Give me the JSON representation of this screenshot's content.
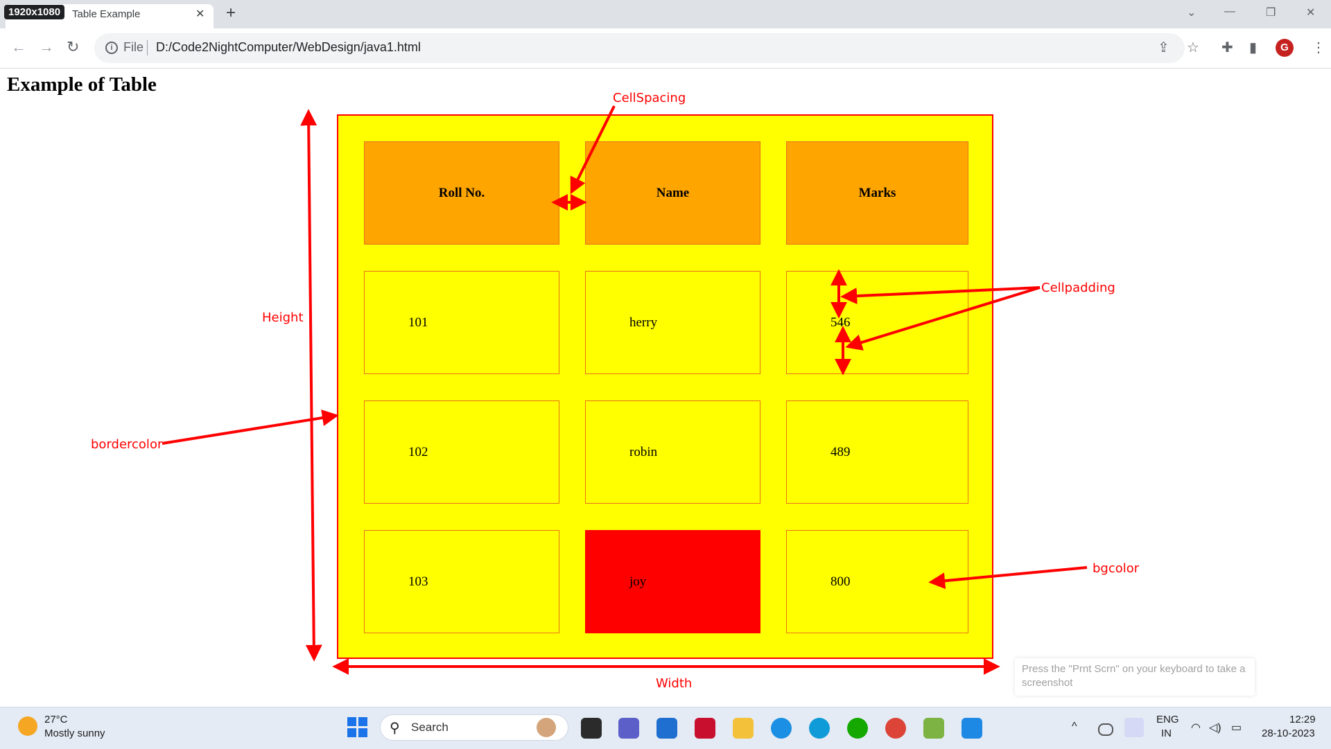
{
  "badge": "1920x1080",
  "tab": {
    "title": "Table Example",
    "close": "✕",
    "new": "+"
  },
  "window": {
    "dropdown": "⌄",
    "minimize": "—",
    "restore": "❐",
    "close": "✕"
  },
  "toolbar": {
    "back": "←",
    "forward": "→",
    "reload": "↻",
    "file_label": "File",
    "url": "D:/Code2NightComputer/WebDesign/java1.html",
    "share": "⇪",
    "star": "☆",
    "extensions": "✚",
    "sidepanel": "▮",
    "profile": "G",
    "menu": "⋮"
  },
  "page": {
    "heading": "Example of Table",
    "table": {
      "headers": [
        "Roll No.",
        "Name",
        "Marks"
      ],
      "rows": [
        [
          "101",
          "herry",
          "546"
        ],
        [
          "102",
          "robin",
          "489"
        ],
        [
          "103",
          "joy",
          "800"
        ]
      ]
    },
    "colors": {
      "table_bg": "#ffff00",
      "header_bg": "#ffa500",
      "highlight_cell": "#ff0000",
      "border": "#ff0000"
    }
  },
  "annotations": {
    "cellspacing": "CellSpacing",
    "cellpadding": "Cellpadding",
    "height": "Height",
    "bordercolor": "bordercolor",
    "bgcolor": "bgcolor",
    "width": "Width"
  },
  "toast": "Press the \"Prnt Scrn\" on your keyboard to take a screenshot",
  "taskbar": {
    "weather_temp": "27°C",
    "weather_desc": "Mostly sunny",
    "search": "Search",
    "search_glyph": "⚲",
    "lang_line1": "ENG",
    "lang_line2": "IN",
    "time": "12:29",
    "date": "28-10-2023",
    "tray_up": "^",
    "wifi": "◠",
    "volume": "◁)",
    "battery": "▭"
  }
}
